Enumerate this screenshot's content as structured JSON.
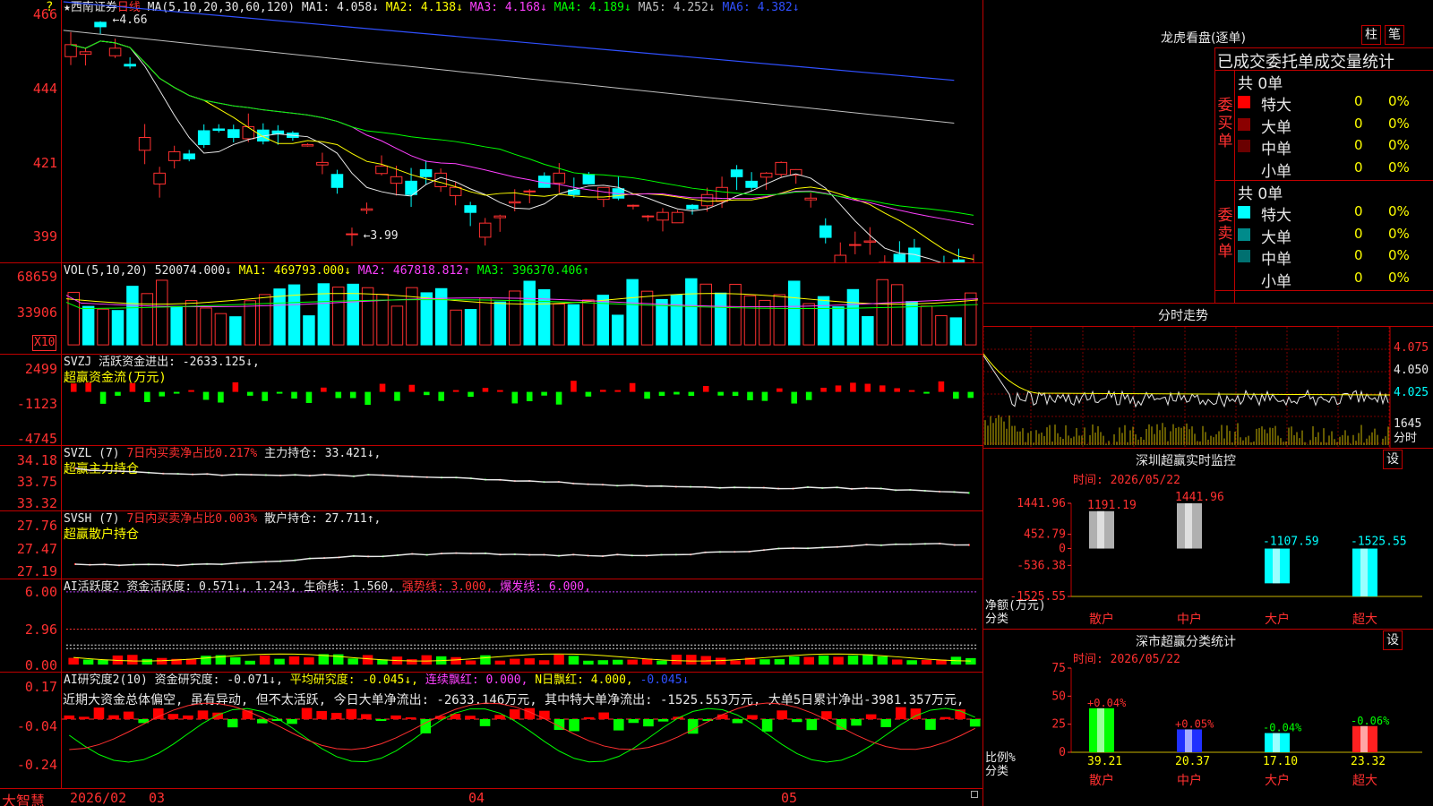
{
  "app": {
    "logo": "大智慧",
    "x10_label": "X10",
    "corner_marker": "?"
  },
  "candle_pane": {
    "legend": {
      "star_name": "★西南证券",
      "period": "日线",
      "ma_def": "MA(5,10,20,30,60,120)",
      "ma1": "MA1: 4.058↓",
      "ma2": "MA2: 4.138↓",
      "ma3": "MA3: 4.168↓",
      "ma4": "MA4: 4.189↓",
      "ma5": "MA5: 4.252↓",
      "ma6": "MA6: 4.382↓"
    },
    "ticks": [
      "466",
      "444",
      "421",
      "399"
    ],
    "high_label": "4.66",
    "low_label": "3.99"
  },
  "vol_pane": {
    "legend": {
      "def": "VOL(5,10,20)",
      "vol": "520074.000↓",
      "ma1": "MA1: 469793.000↓",
      "ma2": "MA2: 467818.812↑",
      "ma3": "MA3: 396370.406↑"
    },
    "ticks": [
      "68659",
      "33906"
    ]
  },
  "svzj_pane": {
    "legend": {
      "def": "SVZJ",
      "text": "活跃资金进出: -2633.125↓,"
    },
    "note": "超赢资金流(万元)",
    "ticks": [
      "2499",
      "-1123",
      "-4745"
    ]
  },
  "svzl_pane": {
    "legend": {
      "def": "SVZL (7)",
      "ratio": "7日内买卖净占比0.217%",
      "hold": "主力持仓: 33.421↓,"
    },
    "note": "超赢主力持仓",
    "ticks": [
      "34.18",
      "33.75",
      "33.32"
    ]
  },
  "svsh_pane": {
    "legend": {
      "def": "SVSH (7)",
      "ratio": "7日内买卖净占比0.003%",
      "hold": "散户持仓: 27.711↑,"
    },
    "note": "超赢散户持仓",
    "ticks": [
      "27.76",
      "27.47",
      "27.19"
    ]
  },
  "ai_act_pane": {
    "legend": {
      "def": "AI活跃度2",
      "act": "资金活跃度: 0.571↓, 1.243,",
      "life": "生命线: 1.560,",
      "strong": "强势线: 3.000,",
      "burst": "爆发线: 6.000,"
    },
    "ticks": [
      "6.00",
      "2.96",
      "0.00"
    ]
  },
  "ai_res_pane": {
    "legend": {
      "def": "AI研究度2(10)",
      "res": "资金研究度: -0.071↓,",
      "avg": "平均研究度: -0.045↓,",
      "cont": "连续飘红: 0.000,",
      "nday": "N日飘红: 4.000,",
      "last": "-0.045↓"
    },
    "text": "近期大资金总体偏空, 虽有异动, 但不太活跃, 今日大单净流出: -2633.146万元, 其中特大单净流出: -1525.553万元, 大单5日累计净出-3981.357万元,",
    "ticks": [
      "0.17",
      "-0.04",
      "-0.24"
    ]
  },
  "x_axis": {
    "labels": [
      "2026/02",
      "03",
      "04",
      "05"
    ]
  },
  "long_hu": {
    "title": "龙虎看盘(逐单)",
    "btn_bar": "柱",
    "btn_pen": "笔",
    "header": "已成交委托单成交量统计",
    "buy_label": "委买单",
    "sell_label": "委卖单",
    "buy_total": "共 0单",
    "sell_total": "共 0单",
    "rows": [
      "特大",
      "大单",
      "中单",
      "小单"
    ],
    "buy_colors": [
      "#ff0000",
      "#8b0000",
      "#6a0000",
      "#000000"
    ],
    "sell_colors": [
      "#00ffff",
      "#008b8b",
      "#007070",
      "#000000"
    ],
    "value": "0",
    "pct": "0%"
  },
  "fenshi": {
    "title": "分时走势",
    "prices": [
      "4.075",
      "4.050",
      "4.025"
    ],
    "vol": "1645",
    "vol_unit": "分时"
  },
  "sz_monitor": {
    "title": "深圳超赢实时监控",
    "btn": "设",
    "time": "时间: 2026/05/22",
    "ticks": [
      "1441.96",
      "452.79",
      "0",
      "-536.38",
      "-1525.55"
    ],
    "y_label": "净额(万元)",
    "x_label": "分类",
    "categories": [
      "散户",
      "中户",
      "大户",
      "超大"
    ],
    "values": [
      1191.19,
      1441.96,
      -1107.59,
      -1525.55
    ],
    "value_labels": [
      "1191.19",
      "1441.96",
      "-1107.59",
      "-1525.55"
    ]
  },
  "sz_class": {
    "title": "深市超赢分类统计",
    "btn": "设",
    "time": "时间: 2026/05/22",
    "ticks": [
      "75",
      "50",
      "25",
      "0"
    ],
    "y_label": "比例%",
    "x_label": "分类",
    "categories": [
      "散户",
      "中户",
      "大户",
      "超大"
    ],
    "values": [
      39.21,
      20.37,
      17.1,
      23.32
    ],
    "value_labels": [
      "39.21",
      "20.37",
      "17.10",
      "23.32"
    ],
    "change_labels": [
      "+0.04%",
      "+0.05%",
      "-0.04%",
      "-0.06%"
    ]
  },
  "chart_data": [
    {
      "type": "bar",
      "title": "深圳超赢实时监控",
      "categories": [
        "散户",
        "中户",
        "大户",
        "超大"
      ],
      "values": [
        1191.19,
        1441.96,
        -1107.59,
        -1525.55
      ],
      "ylabel": "净额(万元)",
      "xlabel": "分类",
      "ylim": [
        -1525.55,
        1441.96
      ]
    },
    {
      "type": "bar",
      "title": "深市超赢分类统计",
      "categories": [
        "散户",
        "中户",
        "大户",
        "超大"
      ],
      "values": [
        39.21,
        20.37,
        17.1,
        23.32
      ],
      "ylabel": "比例%",
      "xlabel": "分类",
      "ylim": [
        0,
        75
      ]
    }
  ]
}
